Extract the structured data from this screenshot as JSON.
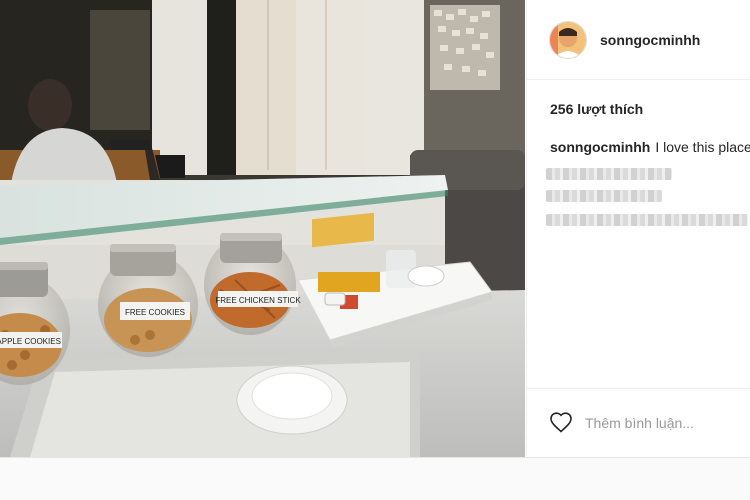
{
  "post": {
    "username": "sonngocminhh",
    "likes_text": "256 lượt thích",
    "caption": {
      "username": "sonngocminhh",
      "text": "I love this place"
    },
    "photo": {
      "jar_labels": [
        "EAPPLE COOKIES",
        "FREE COOKIES",
        "FREE CHICKEN STICK"
      ]
    },
    "comment_placeholder": "Thêm bình luận...",
    "icons": {
      "like": "heart-outline-icon",
      "avatar": "profile-avatar"
    }
  }
}
